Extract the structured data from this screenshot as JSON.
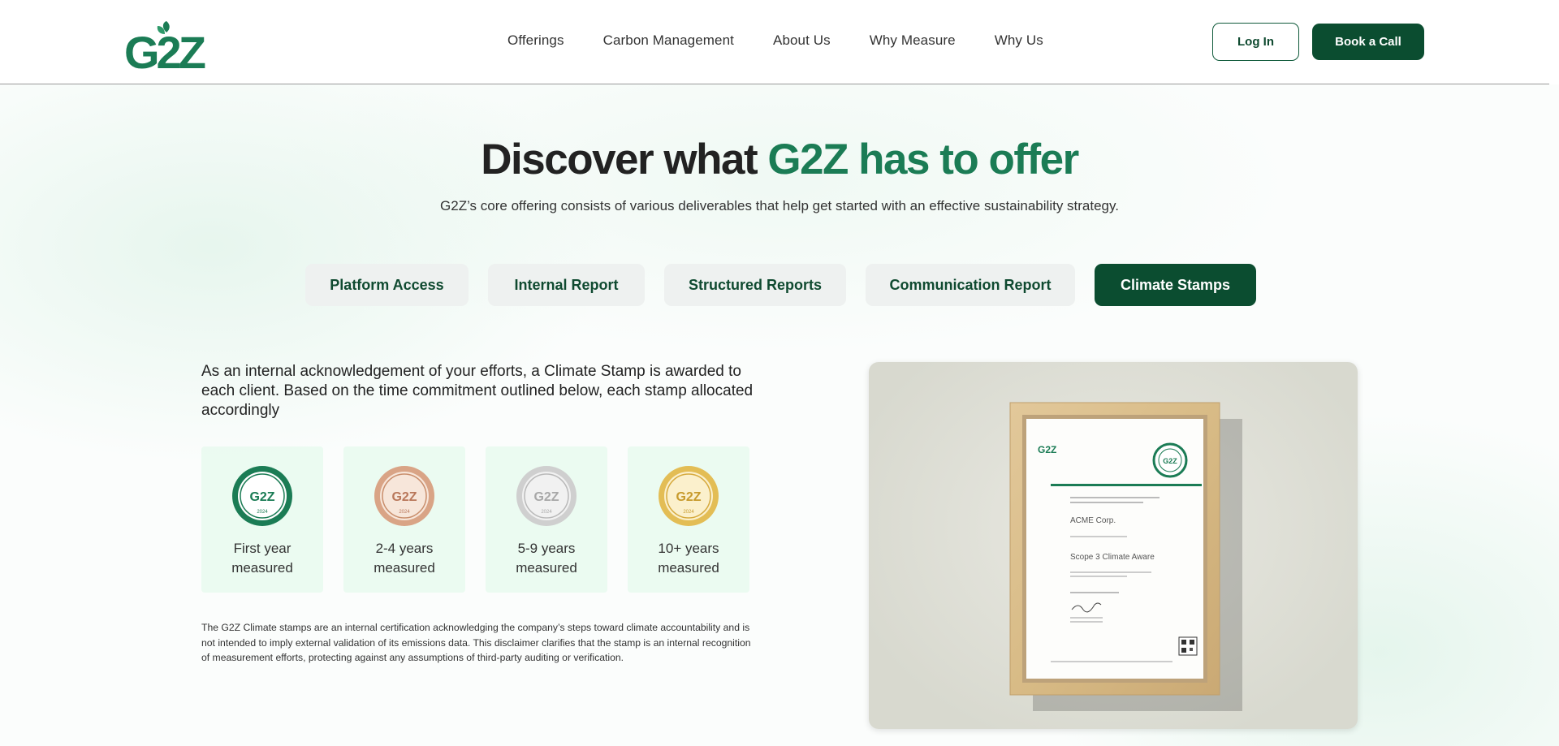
{
  "brand": {
    "logo_text": "G2Z",
    "primary_color": "#0b4d30",
    "accent_color": "#1b7c55"
  },
  "nav": {
    "items": [
      "Offerings",
      "Carbon Management",
      "About Us",
      "Why Measure",
      "Why Us"
    ],
    "login_label": "Log In",
    "book_call_label": "Book a Call"
  },
  "hero": {
    "title_plain": "Discover what ",
    "title_accent": "G2Z has to offer",
    "subtitle": "G2Z’s core offering consists of various deliverables that help get started with an effective sustainability strategy."
  },
  "tabs": {
    "items": [
      {
        "label": "Platform Access",
        "active": false
      },
      {
        "label": "Internal Report",
        "active": false
      },
      {
        "label": "Structured Reports",
        "active": false
      },
      {
        "label": "Communication Report",
        "active": false
      },
      {
        "label": "Climate Stamps",
        "active": true
      }
    ]
  },
  "content": {
    "intro": "As an internal acknowledgement of your efforts, a Climate Stamp is awarded to each client. Based on the time commitment outlined below, each stamp allocated accordingly",
    "stamps": [
      {
        "label": "First year measured",
        "icon": "green-stamp-icon",
        "color": "#1b7c55",
        "badge_text": "G2Z",
        "year": "2024"
      },
      {
        "label": "2-4 years measured",
        "icon": "bronze-stamp-icon",
        "color": "#c98e6c",
        "badge_text": "G2Z",
        "year": "2024"
      },
      {
        "label": "5-9 years measured",
        "icon": "silver-stamp-icon",
        "color": "#b9b9b9",
        "badge_text": "G2Z",
        "year": "2024"
      },
      {
        "label": "10+ years measured",
        "icon": "gold-stamp-icon",
        "color": "#d6aa3e",
        "badge_text": "G2Z",
        "year": "2024"
      }
    ],
    "disclaimer": "The G2Z Climate stamps are an internal certification acknowledging the company’s steps toward climate accountability and is not intended to imply external validation of its emissions data. This disclaimer clarifies that the stamp is an internal recognition of measurement efforts, protecting against any assumptions of third-party auditing or verification."
  },
  "certificate": {
    "logo": "G2Z",
    "company": "ACME Corp.",
    "title": "Scope 3 Climate Aware"
  }
}
